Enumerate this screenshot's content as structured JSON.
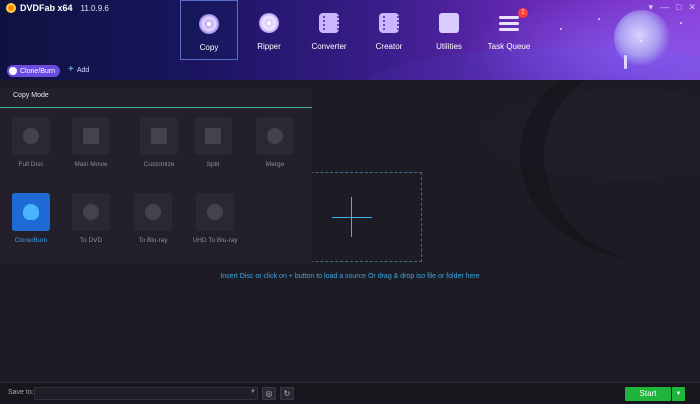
{
  "app": {
    "name": "DVDFab x64",
    "version": "11.0.9.6"
  },
  "window_controls": [
    "▾",
    "—",
    "□",
    "✕"
  ],
  "nav": {
    "tabs": [
      {
        "label": "Copy",
        "icon": "disc-copy-icon",
        "active": true
      },
      {
        "label": "Ripper",
        "icon": "disc-ripper-icon"
      },
      {
        "label": "Converter",
        "icon": "film-converter-icon"
      },
      {
        "label": "Creator",
        "icon": "film-creator-icon"
      },
      {
        "label": "Utilities",
        "icon": "folder-utilities-icon"
      },
      {
        "label": "Task Queue",
        "icon": "task-queue-icon",
        "badge": "1"
      }
    ]
  },
  "toolbar": {
    "clone_burn": "Clone/Burn",
    "add": "Add"
  },
  "copy_mode": {
    "title": "Copy Mode",
    "modes": [
      {
        "label": "Full Disc",
        "icon": "disc-icon"
      },
      {
        "label": "Main Movie",
        "icon": "film-icon"
      },
      {
        "label": "Customize",
        "icon": "edit-icon"
      },
      {
        "label": "Split",
        "icon": "split-icon"
      },
      {
        "label": "Merge",
        "icon": "merge-icon"
      },
      {
        "label": "Clone/Burn",
        "icon": "flame-disc-icon",
        "active": true
      },
      {
        "label": "To DVD",
        "icon": "dvd-icon"
      },
      {
        "label": "To Blu-ray",
        "icon": "bluray-icon"
      },
      {
        "label": "UHD To Blu-ray",
        "icon": "uhd-icon"
      }
    ]
  },
  "dropzone": {
    "hint": "Insert Disc or click on + button to load a source Or drag & drop iso file or folder here"
  },
  "bottom": {
    "save_to_label": "Save to:",
    "save_to_value": "",
    "start_label": "Start"
  },
  "colors": {
    "accent": "#1e6bd6",
    "start": "#1eb53a",
    "hint": "#3aa8e0"
  }
}
